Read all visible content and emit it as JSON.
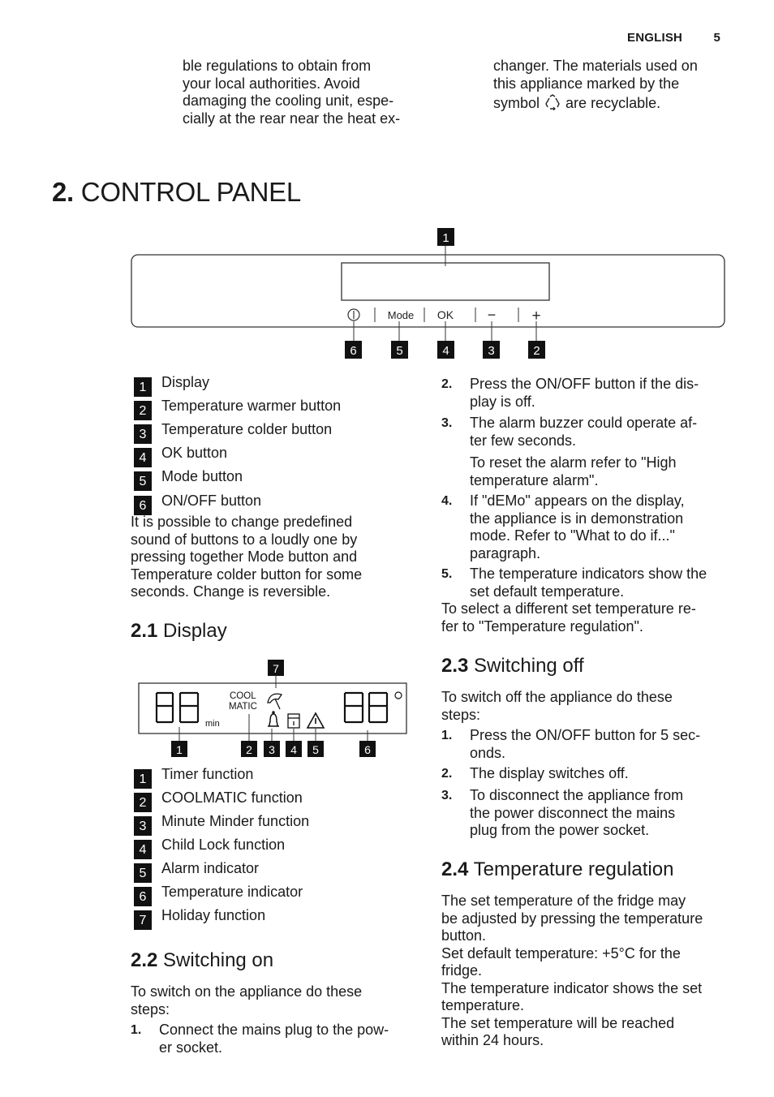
{
  "header": {
    "language": "ENGLISH",
    "page_number": "5"
  },
  "intro": {
    "left_lines": [
      "ble regulations to obtain from",
      "your local authorities. Avoid",
      "damaging the cooling unit, espe-",
      "cially at the rear near the heat ex-"
    ],
    "right_lines": [
      "changer. The materials used on",
      "this appliance marked by the"
    ],
    "right_line3_before": "symbol",
    "right_line3_after": "are recyclable.",
    "recycle_icon": "recycle-icon"
  },
  "section": {
    "number": "2.",
    "title": "CONTROL PANEL"
  },
  "control_panel_diagram": {
    "buttons": [
      {
        "icon": "power-icon",
        "label": ""
      },
      {
        "label": "Mode"
      },
      {
        "label": "OK"
      },
      {
        "label": "−"
      },
      {
        "label": "+"
      }
    ],
    "callouts": {
      "display": "1",
      "on_off": "6",
      "mode": "5",
      "ok": "4",
      "minus": "3",
      "plus": "2"
    }
  },
  "panel_legend": [
    {
      "num": "1",
      "label": "Display"
    },
    {
      "num": "2",
      "label": "Temperature warmer button"
    },
    {
      "num": "3",
      "label": "Temperature colder button"
    },
    {
      "num": "4",
      "label": "OK button"
    },
    {
      "num": "5",
      "label": "Mode button"
    },
    {
      "num": "6",
      "label": "ON/OFF button"
    }
  ],
  "panel_note_lines": [
    "It is possible to change predefined",
    "sound of buttons to a loudly one by",
    "pressing together Mode button and",
    "Temperature colder button for some",
    "seconds. Change is reversible."
  ],
  "display_section": {
    "heading_num": "2.1",
    "heading": "Display",
    "diagram": {
      "digits_left": "88",
      "unit_left": "min",
      "cool_line1": "COOL",
      "cool_line2": "MATIC",
      "digits_right": "88",
      "degree": "°",
      "callouts": [
        "1",
        "2",
        "3",
        "4",
        "5",
        "6",
        "7"
      ]
    },
    "legend": [
      {
        "num": "1",
        "label": "Timer function"
      },
      {
        "num": "2",
        "label": "COOLMATIC function"
      },
      {
        "num": "3",
        "label": "Minute Minder function"
      },
      {
        "num": "4",
        "label": "Child Lock function"
      },
      {
        "num": "5",
        "label": "Alarm indicator"
      },
      {
        "num": "6",
        "label": "Temperature indicator"
      },
      {
        "num": "7",
        "label": "Holiday function"
      }
    ]
  },
  "switching_on": {
    "heading_num": "2.2",
    "heading": "Switching on",
    "intro_lines": [
      "To switch on the appliance do these",
      "steps:"
    ],
    "steps": [
      {
        "num": "1.",
        "lines": [
          "Connect the mains plug to the pow-",
          "er socket."
        ]
      },
      {
        "num": "2.",
        "lines": [
          "Press the ON/OFF button if the dis-",
          "play is off."
        ]
      },
      {
        "num": "3.",
        "lines": [
          "The alarm buzzer could operate af-",
          "ter few seconds."
        ],
        "note_lines": [
          "To reset the alarm refer to \"High",
          "temperature alarm\"."
        ]
      },
      {
        "num": "4.",
        "lines": [
          "If \"dEMo\" appears on the display,",
          "the appliance is in demonstration",
          "mode. Refer to \"What to do if...\"",
          "paragraph."
        ]
      },
      {
        "num": "5.",
        "lines": [
          "The temperature indicators show the",
          "set default temperature."
        ]
      }
    ],
    "outro_lines": [
      "To select a different set temperature re-",
      "fer to \"Temperature regulation\"."
    ]
  },
  "switching_off": {
    "heading_num": "2.3",
    "heading": "Switching off",
    "intro_lines": [
      "To switch off the appliance do these",
      "steps:"
    ],
    "steps": [
      {
        "num": "1.",
        "lines": [
          "Press the ON/OFF button for 5 sec-",
          "onds."
        ]
      },
      {
        "num": "2.",
        "lines": [
          "The display switches off."
        ]
      },
      {
        "num": "3.",
        "lines": [
          "To disconnect the appliance from",
          "the power disconnect the mains",
          "plug from the power socket."
        ]
      }
    ]
  },
  "temperature_regulation": {
    "heading_num": "2.4",
    "heading": "Temperature regulation",
    "lines": [
      "The set temperature of the fridge may",
      "be adjusted by pressing the temperature",
      "button.",
      "Set default temperature: +5°C for the",
      "fridge.",
      "The temperature indicator shows the set",
      "temperature.",
      "The set temperature will be reached",
      "within 24 hours."
    ]
  }
}
